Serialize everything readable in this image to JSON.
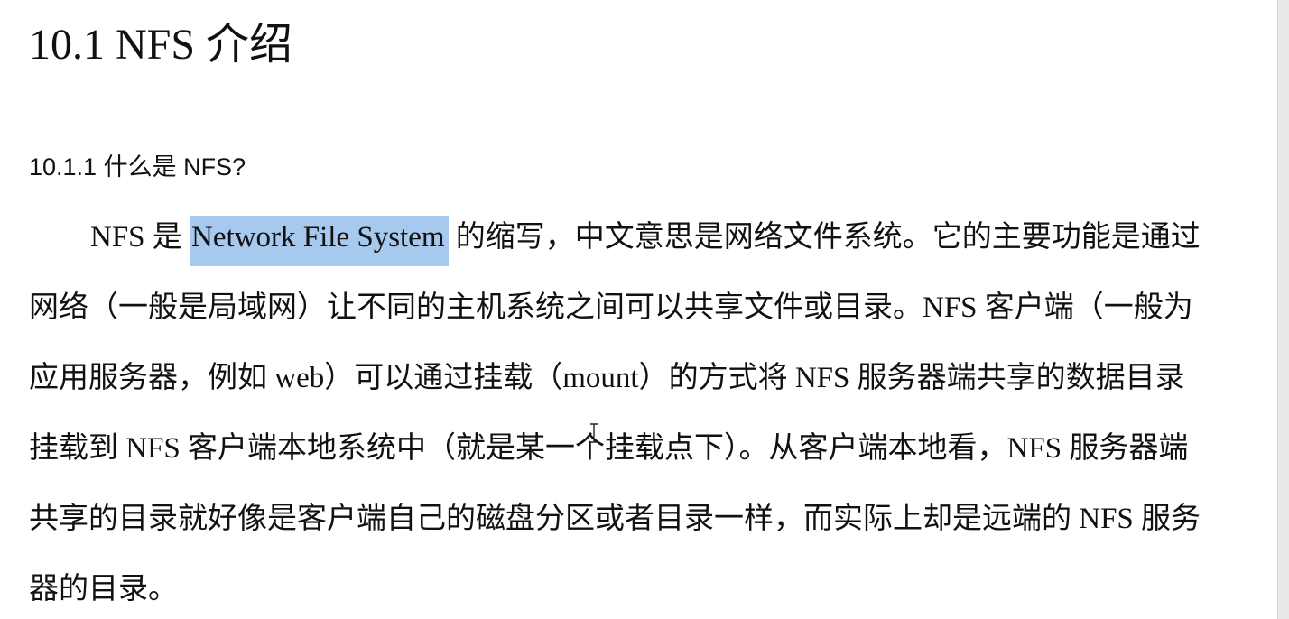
{
  "heading": {
    "title": "10.1 NFS 介绍"
  },
  "section": {
    "title": "10.1.1 什么是 NFS?"
  },
  "paragraph": {
    "line1_lead": "NFS 是 ",
    "line1_highlight": "Network File System",
    "line1_tail": " 的缩写，中文意思是网络文件系统。它的主要功能是通过",
    "line2": "网络（一般是局域网）让不同的主机系统之间可以共享文件或目录。NFS 客户端（一般为",
    "line3": "应用服务器，例如 web）可以通过挂载（mount）的方式将 NFS 服务器端共享的数据目录",
    "line4": "挂载到 NFS 客户端本地系统中（就是某一个挂载点下）。从客户端本地看，NFS 服务器端",
    "line5": "共享的目录就好像是客户端自己的磁盘分区或者目录一样，而实际上却是远端的 NFS 服务",
    "line6": "器的目录。"
  },
  "colors": {
    "highlight": "#a7c9ee",
    "text": "#111111",
    "background": "#ffffff"
  },
  "icons": {
    "cursor": "text-cursor-icon"
  }
}
